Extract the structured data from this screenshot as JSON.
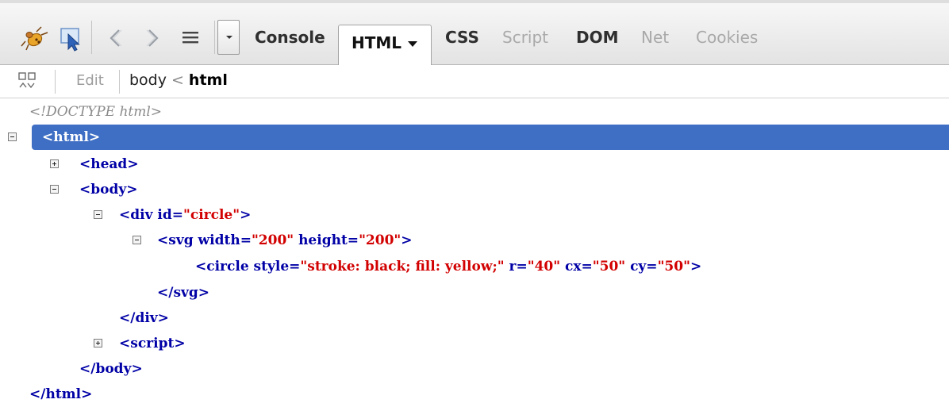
{
  "toolbar": {
    "tabs": {
      "console": "Console",
      "html": "HTML",
      "css": "CSS",
      "script": "Script",
      "dom": "DOM",
      "net": "Net",
      "cookies": "Cookies"
    }
  },
  "subbar": {
    "edit": "Edit",
    "breadcrumb": {
      "parent": "body",
      "separator": "<",
      "current": "html"
    }
  },
  "tree": {
    "doctype": "<!DOCTYPE html>",
    "html_open": "<html>",
    "head": "<head>",
    "body_open": "<body>",
    "div_open_tag": "<div",
    "div_attr_name": " id=",
    "div_attr_value": "\"circle\"",
    "div_close_bracket": ">",
    "svg_open_tag": "<svg",
    "svg_attr1_name": " width=",
    "svg_attr1_value": "\"200\"",
    "svg_attr2_name": " height=",
    "svg_attr2_value": "\"200\"",
    "svg_close_bracket": ">",
    "circle_open_tag": "<circle",
    "circle_attr1_name": " style=",
    "circle_attr1_value": "\"stroke: black; fill: yellow;\"",
    "circle_attr2_name": " r=",
    "circle_attr2_value": "\"40\"",
    "circle_attr3_name": " cx=",
    "circle_attr3_value": "\"50\"",
    "circle_attr4_name": " cy=",
    "circle_attr4_value": "\"50\"",
    "circle_close_bracket": ">",
    "svg_close": "</svg>",
    "div_close": "</div>",
    "script": "<script>",
    "body_close": "</body>",
    "html_close": "</html>"
  },
  "colors": {
    "selection": "#3f6fc4",
    "tag": "#0000a6",
    "attr_value": "#d20000",
    "doctype": "#8a8a8a"
  }
}
